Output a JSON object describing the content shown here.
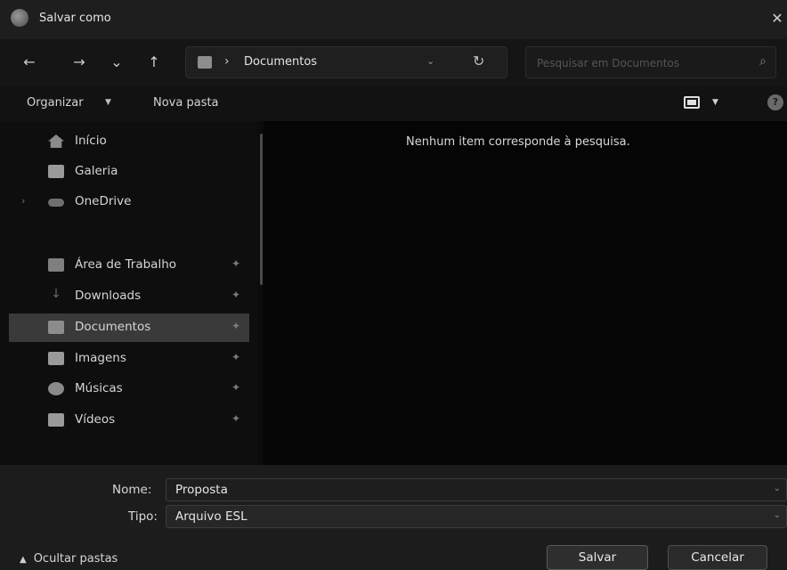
{
  "window": {
    "title": "Salvar como"
  },
  "nav": {
    "back": "←",
    "forward": "→",
    "recent": "⌄",
    "up": "↑",
    "breadcrumb_separator": "›",
    "address": "Documentos",
    "refresh": "↻",
    "search_placeholder": "Pesquisar em Documentos"
  },
  "toolbar": {
    "organize_label": "Organizar",
    "new_folder_label": "Nova pasta",
    "help": "?"
  },
  "sidebar": {
    "items": [
      {
        "label": "Início",
        "icon": "home-icon",
        "color": "#8a8a8a"
      },
      {
        "label": "Galeria",
        "icon": "gallery-icon",
        "color": "#9a9a9a"
      },
      {
        "label": "OneDrive",
        "icon": "cloud-icon",
        "color": "#6f6f6f",
        "expandable": true
      },
      {
        "label": "Área de Trabalho",
        "icon": "desktop-icon",
        "color": "#7f7f7f",
        "pinned": true
      },
      {
        "label": "Downloads",
        "icon": "download-icon",
        "color": "#5a5a5a",
        "pinned": true
      },
      {
        "label": "Documentos",
        "icon": "documents-icon",
        "color": "#8c8c8c",
        "pinned": true,
        "selected": true
      },
      {
        "label": "Imagens",
        "icon": "pictures-icon",
        "color": "#9a9a9a",
        "pinned": true
      },
      {
        "label": "Músicas",
        "icon": "music-icon",
        "color": "#8a8a8a",
        "pinned": true
      },
      {
        "label": "Vídeos",
        "icon": "videos-icon",
        "color": "#9a9a9a",
        "pinned": true
      }
    ]
  },
  "content": {
    "empty_message": "Nenhum item corresponde à pesquisa."
  },
  "form": {
    "name_label": "Nome:",
    "name_value": "Proposta",
    "type_label": "Tipo:",
    "type_value": "Arquivo ESL"
  },
  "footer": {
    "hide_folders_label": "Ocultar pastas",
    "save_label": "Salvar",
    "cancel_label": "Cancelar"
  }
}
